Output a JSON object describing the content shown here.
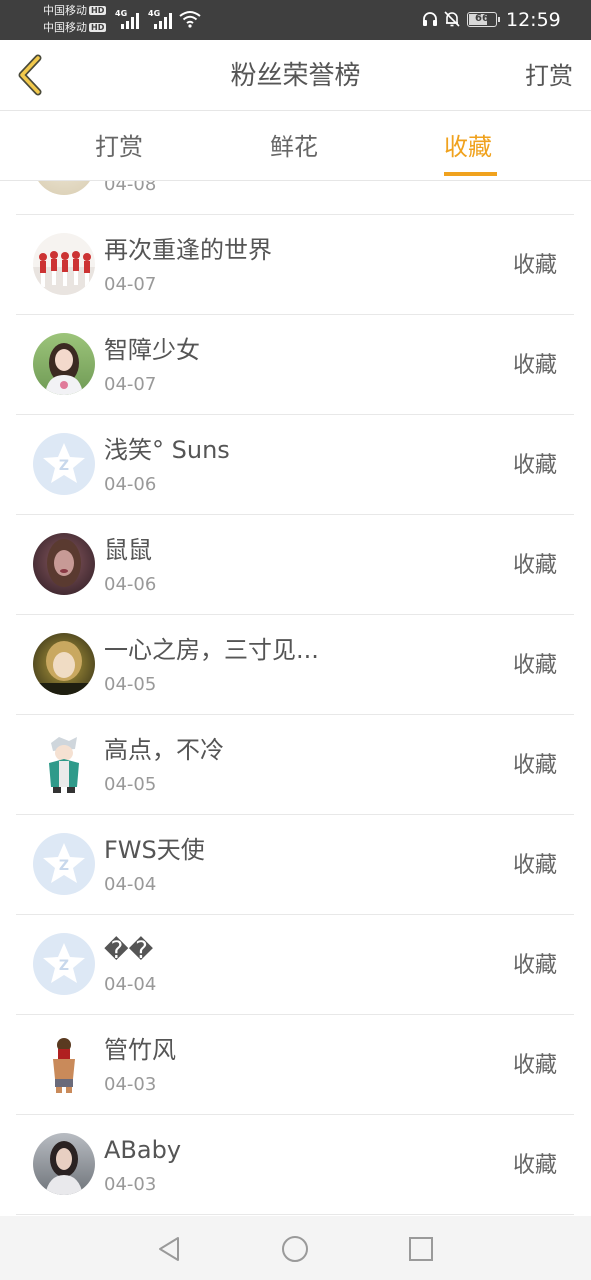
{
  "status_bar": {
    "carrier1": "中国移动",
    "carrier2": "中国移动",
    "hd1": "HD",
    "hd2": "HD",
    "signal1_type": "4G",
    "signal2_type": "4G",
    "battery": "66",
    "time": "12:59",
    "icons": [
      "signal-icon",
      "wifi-icon",
      "headset-icon",
      "bell-off-icon",
      "battery-icon"
    ]
  },
  "header": {
    "title": "粉丝荣誉榜",
    "action": "打赏",
    "back_icon": "chevron-left-icon",
    "accent_color": "#f0a21e"
  },
  "tabs": [
    {
      "label": "打赏",
      "active": false
    },
    {
      "label": "鲜花",
      "active": false
    },
    {
      "label": "收藏",
      "active": true
    }
  ],
  "list": {
    "partial_row": {
      "date": "04-08"
    },
    "items": [
      {
        "name": "再次重逢的世界",
        "date": "04-07",
        "status": "收藏"
      },
      {
        "name": "智障少女",
        "date": "04-07",
        "status": "收藏"
      },
      {
        "name": "浅笑° Suns",
        "date": "04-06",
        "status": "收藏"
      },
      {
        "name": "鼠鼠",
        "date": "04-06",
        "status": "收藏"
      },
      {
        "name": "一心之房，三寸见...",
        "date": "04-05",
        "status": "收藏"
      },
      {
        "name": "高点，不冷",
        "date": "04-05",
        "status": "收藏"
      },
      {
        "name": "FWS天使",
        "date": "04-04",
        "status": "收藏"
      },
      {
        "name": "��",
        "date": "04-04",
        "status": "收藏"
      },
      {
        "name": "管竹风",
        "date": "04-03",
        "status": "收藏"
      },
      {
        "name": "ABaby",
        "date": "04-03",
        "status": "收藏"
      }
    ]
  },
  "system_nav": {
    "icons": [
      "back-triangle-icon",
      "home-circle-icon",
      "recents-square-icon"
    ]
  }
}
